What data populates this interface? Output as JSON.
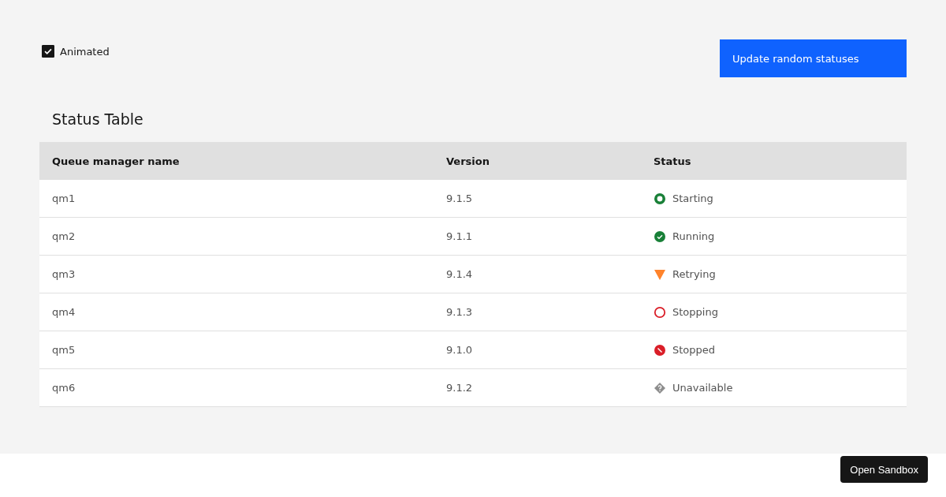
{
  "animated": {
    "label": "Animated",
    "checked": true
  },
  "update_button": "Update random statuses",
  "table": {
    "title": "Status Table",
    "columns": [
      "Queue manager name",
      "Version",
      "Status"
    ],
    "rows": [
      {
        "name": "qm1",
        "version": "9.1.5",
        "status": {
          "label": "Starting",
          "kind": "starting",
          "color": "#198038"
        }
      },
      {
        "name": "qm2",
        "version": "9.1.1",
        "status": {
          "label": "Running",
          "kind": "running",
          "color": "#198038"
        }
      },
      {
        "name": "qm3",
        "version": "9.1.4",
        "status": {
          "label": "Retrying",
          "kind": "retrying",
          "color": "#ff832b"
        }
      },
      {
        "name": "qm4",
        "version": "9.1.3",
        "status": {
          "label": "Stopping",
          "kind": "stopping",
          "color": "#da1e28"
        }
      },
      {
        "name": "qm5",
        "version": "9.1.0",
        "status": {
          "label": "Stopped",
          "kind": "stopped",
          "color": "#da1e28"
        }
      },
      {
        "name": "qm6",
        "version": "9.1.2",
        "status": {
          "label": "Unavailable",
          "kind": "unavailable",
          "color": "#8d8d8d"
        }
      }
    ]
  },
  "sandbox_button": "Open Sandbox"
}
